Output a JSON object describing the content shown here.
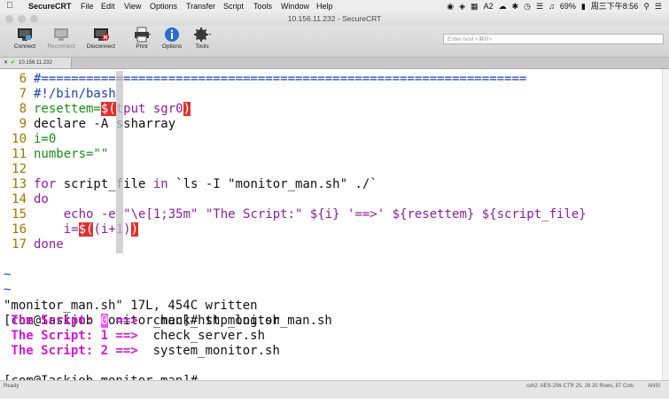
{
  "menubar": {
    "app_name": "SecureCRT",
    "items": [
      "File",
      "Edit",
      "View",
      "Options",
      "Transfer",
      "Script",
      "Tools",
      "Window",
      "Help"
    ],
    "status_icon_text": "2",
    "battery": "69%",
    "clock": "周三下午8:56"
  },
  "window": {
    "title": "10.156.11.232 - SecureCRT"
  },
  "toolbar": {
    "connect": "Connect",
    "reconnect": "Reconnect",
    "disconnect": "Disconnect",
    "print": "Print",
    "options": "Options",
    "tools": "Tools",
    "host_placeholder": "Enter host <⌘R>"
  },
  "tab": {
    "title": "10.156.11.232"
  },
  "editor": {
    "lines": [
      {
        "num": "6",
        "parts": [
          {
            "t": "#=================================================================",
            "c": "blue"
          }
        ]
      },
      {
        "num": "7",
        "parts": [
          {
            "t": "#!/bin/bash",
            "c": "blue"
          }
        ]
      },
      {
        "num": "8",
        "parts": [
          {
            "t": "resettem=",
            "c": "green"
          },
          {
            "t": "$(",
            "c": "redbox"
          },
          {
            "t": "tput sgr0",
            "c": "purple"
          },
          {
            "t": ")",
            "c": "redbox"
          }
        ]
      },
      {
        "num": "9",
        "parts": [
          {
            "t": "declare -A ssharray",
            "c": "black"
          }
        ]
      },
      {
        "num": "10",
        "parts": [
          {
            "t": "i=0",
            "c": "green"
          }
        ]
      },
      {
        "num": "11",
        "parts": [
          {
            "t": "numbers=\"\"",
            "c": "green"
          }
        ]
      },
      {
        "num": "12",
        "parts": [
          {
            "t": "",
            "c": "black"
          }
        ]
      },
      {
        "num": "13",
        "parts": [
          {
            "t": "for ",
            "c": "purple"
          },
          {
            "t": "script_file ",
            "c": "black"
          },
          {
            "t": "in ",
            "c": "purple"
          },
          {
            "t": "`ls -I \"monitor_man.sh\" ./`",
            "c": "black"
          }
        ]
      },
      {
        "num": "14",
        "parts": [
          {
            "t": "do",
            "c": "purple"
          }
        ]
      },
      {
        "num": "15",
        "parts": [
          {
            "t": "    echo -e ",
            "c": "purple"
          },
          {
            "t": "\"\\e[1;35m\" \"The Script:\" ${i} '==>' ${resettem} ${script_file}",
            "c": "purple"
          }
        ]
      },
      {
        "num": "16",
        "parts": [
          {
            "t": "    i=",
            "c": "purple"
          },
          {
            "t": "$(",
            "c": "redbox"
          },
          {
            "t": "(i+1)",
            "c": "purple"
          },
          {
            "t": ")",
            "c": "redbox"
          }
        ]
      },
      {
        "num": "17",
        "parts": [
          {
            "t": "done",
            "c": "purple"
          }
        ]
      }
    ],
    "tildes": [
      "~",
      "~"
    ]
  },
  "output": {
    "write_msg": "\"monitor_man.sh\" 17L, 454C written",
    "prompt1": "[com@Iaskjob monitor_man]# sh monitor_man.sh",
    "script_rows": [
      {
        "label": "The Script: ",
        "num": "0",
        "arrow": " ==>",
        "file": "check_http_log.sh",
        "cursor": true
      },
      {
        "label": "The Script: ",
        "num": "1",
        "arrow": " ==>",
        "file": "check_server.sh",
        "cursor": false
      },
      {
        "label": "The Script: ",
        "num": "2",
        "arrow": " ==>",
        "file": "system_monitor.sh",
        "cursor": false
      }
    ],
    "prompt2": "[com@Iaskjob monitor_man]#"
  },
  "statusbar": {
    "ready": "Ready",
    "info": "ssh2: AES-256-CTR    25, 28  20 Rows, 87 Cols",
    "ansi": "ANSI"
  },
  "colors": {
    "comment": "#1f3fb8",
    "keyword": "#8a1f9a",
    "variable": "#1a8a1a",
    "paren_highlight": "#e03030",
    "output_magenta": "#d01ad0"
  }
}
